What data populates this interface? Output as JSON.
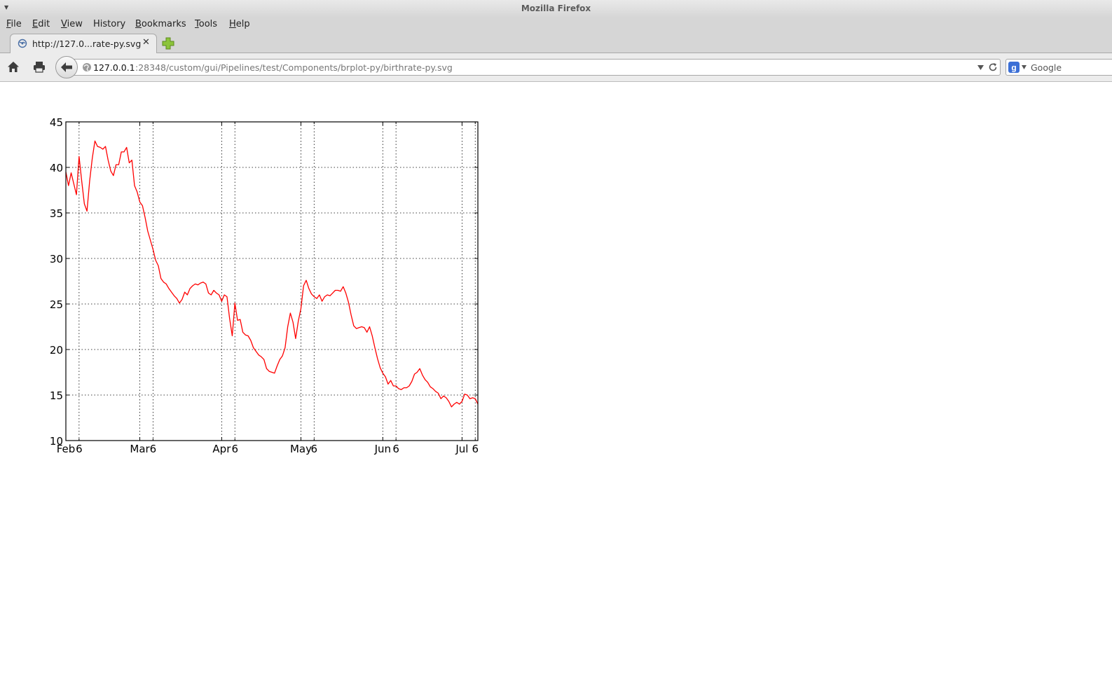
{
  "window": {
    "title": "Mozilla Firefox"
  },
  "menu": {
    "items": [
      {
        "label": "File",
        "accel": "F",
        "rest": "ile"
      },
      {
        "label": "Edit",
        "accel": "E",
        "rest": "dit"
      },
      {
        "label": "View",
        "accel": "V",
        "rest": "iew"
      },
      {
        "label": "History",
        "accel": "",
        "rest": "History"
      },
      {
        "label": "Bookmarks",
        "accel": "B",
        "rest": "ookmarks"
      },
      {
        "label": "Tools",
        "accel": "T",
        "rest": "ools"
      },
      {
        "label": "Help",
        "accel": "H",
        "rest": "elp"
      }
    ]
  },
  "tab": {
    "title": "http://127.0...rate-py.svg",
    "close_glyph": "✕"
  },
  "nav": {
    "url_host": "127.0.0.1",
    "url_rest": ":28348/custom/gui/Pipelines/test/Components/brplot-py/birthrate-py.svg",
    "search_placeholder": "Google"
  },
  "colors": {
    "line": "#ff0000",
    "chrome": "#d6d6d6",
    "accent_new_tab": "#7fb32a"
  },
  "icons": [
    "window-menu-icon",
    "page-favicon-icon",
    "close-tab-icon",
    "new-tab-icon",
    "home-icon",
    "print-icon",
    "back-arrow-icon",
    "site-identity-icon",
    "history-dropdown-icon",
    "reload-icon",
    "google-engine-icon"
  ],
  "chart_data": {
    "type": "line",
    "title": "",
    "xlabel": "",
    "ylabel": "",
    "x_range": [
      "2014-02-01",
      "2014-07-07"
    ],
    "ylim": [
      10,
      45
    ],
    "yticks": [
      10,
      15,
      20,
      25,
      30,
      35,
      40,
      45
    ],
    "ytick_labels": [
      "10",
      "15",
      "20",
      "25",
      "30",
      "35",
      "40",
      "45"
    ],
    "xtick_labels": [
      {
        "label": "Feb",
        "date": "2014-02-01",
        "major": true
      },
      {
        "label": "6",
        "date": "2014-02-06",
        "major": false
      },
      {
        "label": "Mar",
        "date": "2014-03-01",
        "major": true
      },
      {
        "label": "6",
        "date": "2014-03-06",
        "major": false
      },
      {
        "label": "Apr",
        "date": "2014-04-01",
        "major": true
      },
      {
        "label": "6",
        "date": "2014-04-06",
        "major": false
      },
      {
        "label": "May",
        "date": "2014-05-01",
        "major": true
      },
      {
        "label": "6",
        "date": "2014-05-06",
        "major": false
      },
      {
        "label": "Jun",
        "date": "2014-06-01",
        "major": true
      },
      {
        "label": "6",
        "date": "2014-06-06",
        "major": false
      },
      {
        "label": "Jul",
        "date": "2014-07-01",
        "major": true
      },
      {
        "label": "6",
        "date": "2014-07-06",
        "major": false
      }
    ],
    "grid": true,
    "series": [
      {
        "color": "#ff0000",
        "points": [
          [
            "2014-02-01",
            39.5
          ],
          [
            "2014-02-02",
            38.0
          ],
          [
            "2014-02-03",
            39.4
          ],
          [
            "2014-02-04",
            38.2
          ],
          [
            "2014-02-05",
            37.0
          ],
          [
            "2014-02-06",
            41.2
          ],
          [
            "2014-02-07",
            38.5
          ],
          [
            "2014-02-08",
            36.0
          ],
          [
            "2014-02-09",
            35.2
          ],
          [
            "2014-02-10",
            38.5
          ],
          [
            "2014-02-11",
            41.0
          ],
          [
            "2014-02-12",
            42.9
          ],
          [
            "2014-02-13",
            42.3
          ],
          [
            "2014-02-14",
            42.2
          ],
          [
            "2014-02-15",
            42.0
          ],
          [
            "2014-02-16",
            42.3
          ],
          [
            "2014-02-17",
            40.8
          ],
          [
            "2014-02-18",
            39.6
          ],
          [
            "2014-02-19",
            39.1
          ],
          [
            "2014-02-20",
            40.3
          ],
          [
            "2014-02-21",
            40.3
          ],
          [
            "2014-02-22",
            41.7
          ],
          [
            "2014-02-23",
            41.7
          ],
          [
            "2014-02-24",
            42.2
          ],
          [
            "2014-02-25",
            40.5
          ],
          [
            "2014-02-26",
            40.8
          ],
          [
            "2014-02-27",
            38.0
          ],
          [
            "2014-02-28",
            37.3
          ],
          [
            "2014-03-01",
            36.2
          ],
          [
            "2014-03-02",
            35.8
          ],
          [
            "2014-03-03",
            34.5
          ],
          [
            "2014-03-04",
            33.0
          ],
          [
            "2014-03-05",
            32.0
          ],
          [
            "2014-03-06",
            31.0
          ],
          [
            "2014-03-07",
            29.8
          ],
          [
            "2014-03-08",
            29.2
          ],
          [
            "2014-03-09",
            27.8
          ],
          [
            "2014-03-10",
            27.4
          ],
          [
            "2014-03-11",
            27.2
          ],
          [
            "2014-03-12",
            26.7
          ],
          [
            "2014-03-13",
            26.3
          ],
          [
            "2014-03-14",
            25.9
          ],
          [
            "2014-03-15",
            25.6
          ],
          [
            "2014-03-16",
            25.1
          ],
          [
            "2014-03-17",
            25.5
          ],
          [
            "2014-03-18",
            26.3
          ],
          [
            "2014-03-19",
            26.0
          ],
          [
            "2014-03-20",
            26.7
          ],
          [
            "2014-03-21",
            27.0
          ],
          [
            "2014-03-22",
            27.2
          ],
          [
            "2014-03-23",
            27.1
          ],
          [
            "2014-03-24",
            27.3
          ],
          [
            "2014-03-25",
            27.4
          ],
          [
            "2014-03-26",
            27.2
          ],
          [
            "2014-03-27",
            26.2
          ],
          [
            "2014-03-28",
            26.0
          ],
          [
            "2014-03-29",
            26.5
          ],
          [
            "2014-03-30",
            26.2
          ],
          [
            "2014-03-31",
            26.0
          ],
          [
            "2014-04-01",
            25.3
          ],
          [
            "2014-04-02",
            26.0
          ],
          [
            "2014-04-03",
            25.8
          ],
          [
            "2014-04-04",
            23.4
          ],
          [
            "2014-04-05",
            21.5
          ],
          [
            "2014-04-06",
            25.1
          ],
          [
            "2014-04-07",
            23.2
          ],
          [
            "2014-04-08",
            23.3
          ],
          [
            "2014-04-09",
            21.9
          ],
          [
            "2014-04-10",
            21.6
          ],
          [
            "2014-04-11",
            21.5
          ],
          [
            "2014-04-12",
            21.0
          ],
          [
            "2014-04-13",
            20.2
          ],
          [
            "2014-04-14",
            19.8
          ],
          [
            "2014-04-15",
            19.4
          ],
          [
            "2014-04-16",
            19.2
          ],
          [
            "2014-04-17",
            18.9
          ],
          [
            "2014-04-18",
            17.9
          ],
          [
            "2014-04-19",
            17.6
          ],
          [
            "2014-04-20",
            17.5
          ],
          [
            "2014-04-21",
            17.4
          ],
          [
            "2014-04-22",
            18.2
          ],
          [
            "2014-04-23",
            18.9
          ],
          [
            "2014-04-24",
            19.3
          ],
          [
            "2014-04-25",
            20.2
          ],
          [
            "2014-04-26",
            22.5
          ],
          [
            "2014-04-27",
            24.0
          ],
          [
            "2014-04-28",
            23.0
          ],
          [
            "2014-04-29",
            21.2
          ],
          [
            "2014-04-30",
            23.1
          ],
          [
            "2014-05-01",
            24.5
          ],
          [
            "2014-05-02",
            27.0
          ],
          [
            "2014-05-03",
            27.6
          ],
          [
            "2014-05-04",
            26.7
          ],
          [
            "2014-05-05",
            26.1
          ],
          [
            "2014-05-06",
            25.8
          ],
          [
            "2014-05-07",
            25.6
          ],
          [
            "2014-05-08",
            26.0
          ],
          [
            "2014-05-09",
            25.3
          ],
          [
            "2014-05-10",
            25.8
          ],
          [
            "2014-05-11",
            26.0
          ],
          [
            "2014-05-12",
            25.9
          ],
          [
            "2014-05-13",
            26.2
          ],
          [
            "2014-05-14",
            26.5
          ],
          [
            "2014-05-15",
            26.5
          ],
          [
            "2014-05-16",
            26.4
          ],
          [
            "2014-05-17",
            26.9
          ],
          [
            "2014-05-18",
            26.2
          ],
          [
            "2014-05-19",
            25.2
          ],
          [
            "2014-05-20",
            23.8
          ],
          [
            "2014-05-21",
            22.6
          ],
          [
            "2014-05-22",
            22.3
          ],
          [
            "2014-05-23",
            22.4
          ],
          [
            "2014-05-24",
            22.5
          ],
          [
            "2014-05-25",
            22.4
          ],
          [
            "2014-05-26",
            21.9
          ],
          [
            "2014-05-27",
            22.5
          ],
          [
            "2014-05-28",
            21.5
          ],
          [
            "2014-05-29",
            20.2
          ],
          [
            "2014-05-30",
            19.0
          ],
          [
            "2014-05-31",
            18.0
          ],
          [
            "2014-06-01",
            17.4
          ],
          [
            "2014-06-02",
            17.0
          ],
          [
            "2014-06-03",
            16.2
          ],
          [
            "2014-06-04",
            16.6
          ],
          [
            "2014-06-05",
            16.0
          ],
          [
            "2014-06-06",
            16.0
          ],
          [
            "2014-06-07",
            15.7
          ],
          [
            "2014-06-08",
            15.6
          ],
          [
            "2014-06-09",
            15.8
          ],
          [
            "2014-06-10",
            15.8
          ],
          [
            "2014-06-11",
            16.0
          ],
          [
            "2014-06-12",
            16.5
          ],
          [
            "2014-06-13",
            17.3
          ],
          [
            "2014-06-14",
            17.5
          ],
          [
            "2014-06-15",
            17.9
          ],
          [
            "2014-06-16",
            17.2
          ],
          [
            "2014-06-17",
            16.7
          ],
          [
            "2014-06-18",
            16.4
          ],
          [
            "2014-06-19",
            15.9
          ],
          [
            "2014-06-20",
            15.7
          ],
          [
            "2014-06-21",
            15.4
          ],
          [
            "2014-06-22",
            15.2
          ],
          [
            "2014-06-23",
            14.6
          ],
          [
            "2014-06-24",
            14.9
          ],
          [
            "2014-06-25",
            14.7
          ],
          [
            "2014-06-26",
            14.3
          ],
          [
            "2014-06-27",
            13.7
          ],
          [
            "2014-06-28",
            14.0
          ],
          [
            "2014-06-29",
            14.2
          ],
          [
            "2014-06-30",
            14.0
          ],
          [
            "2014-07-01",
            14.3
          ],
          [
            "2014-07-02",
            15.1
          ],
          [
            "2014-07-03",
            15.0
          ],
          [
            "2014-07-04",
            14.6
          ],
          [
            "2014-07-05",
            14.7
          ],
          [
            "2014-07-06",
            14.6
          ],
          [
            "2014-07-07",
            14.0
          ]
        ]
      }
    ]
  }
}
